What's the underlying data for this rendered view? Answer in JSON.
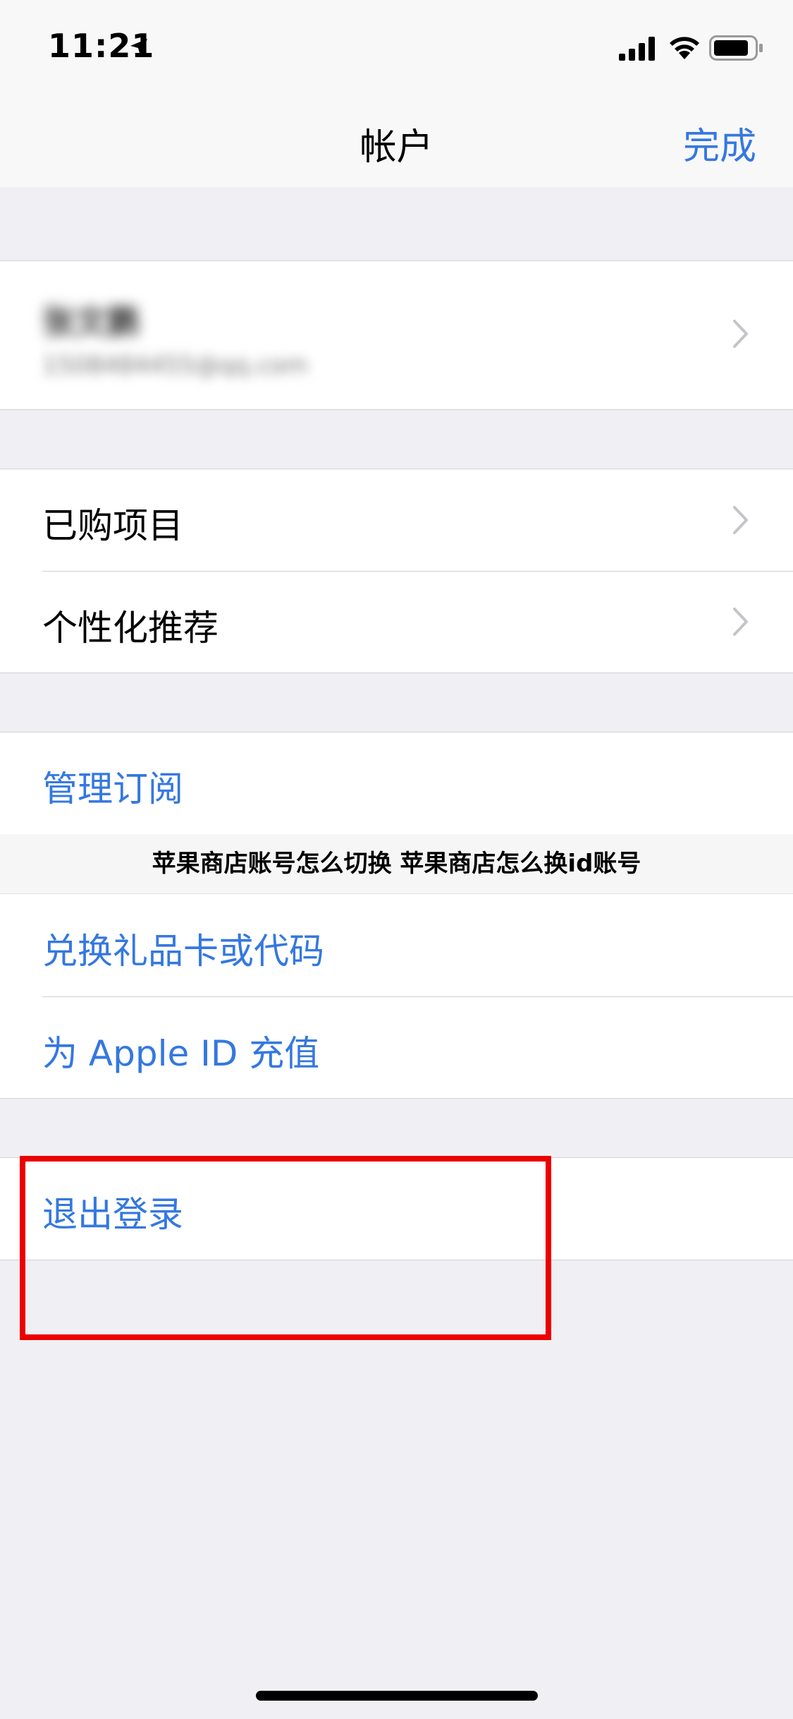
{
  "status_bar": {
    "time": "11:21"
  },
  "nav": {
    "title": "帐户",
    "done_label": "完成"
  },
  "account": {
    "name": "张文鹏",
    "email": "1508484455@qq.com"
  },
  "group_purchases": {
    "purchased": "已购项目",
    "recommendations": "个性化推荐"
  },
  "group_manage": {
    "subscriptions": "管理订阅",
    "redeem": "兑换礼品卡或代码",
    "add_funds": "为 Apple ID 充值"
  },
  "group_signout": {
    "sign_out": "退出登录"
  },
  "caption": "苹果商店账号怎么切换 苹果商店怎么换id账号",
  "colors": {
    "accent": "#3478e0",
    "highlight": "#ec0000",
    "background": "#efeff4"
  },
  "icons": [
    "location-arrow-icon",
    "signal-bars-icon",
    "wifi-icon",
    "battery-icon",
    "chevron-right-icon"
  ]
}
